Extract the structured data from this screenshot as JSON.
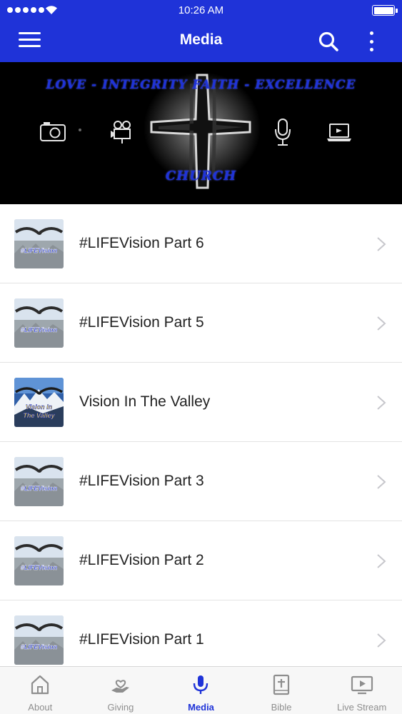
{
  "status_bar": {
    "time": "10:26 AM"
  },
  "header": {
    "title": "Media"
  },
  "banner": {
    "motto": "LOVE - INTEGRITY   FAITH - EXCELLENCE",
    "church": "CHURCH"
  },
  "media_items": [
    {
      "title": "#LIFEVision Part 6",
      "thumb_label": "#LIFEVision"
    },
    {
      "title": "#LIFEVision Part 5",
      "thumb_label": "#LIFEVision"
    },
    {
      "title": "Vision In The Valley",
      "thumb_label_1": "Vision In",
      "thumb_label_2": "The Valley"
    },
    {
      "title": "#LIFEVision Part 3",
      "thumb_label": "#LIFEVision"
    },
    {
      "title": "#LIFEVision Part 2",
      "thumb_label": "#LIFEVision"
    },
    {
      "title": "#LIFEVision Part 1",
      "thumb_label": "#LIFEVision"
    }
  ],
  "tabs": [
    {
      "label": "About",
      "icon": "home-icon"
    },
    {
      "label": "Giving",
      "icon": "giving-hand-icon"
    },
    {
      "label": "Media",
      "icon": "microphone-icon"
    },
    {
      "label": "Bible",
      "icon": "bible-icon"
    },
    {
      "label": "Live Stream",
      "icon": "tv-play-icon"
    }
  ],
  "colors": {
    "brand": "#1f33d8",
    "tab_inactive": "#8e8e8e"
  }
}
